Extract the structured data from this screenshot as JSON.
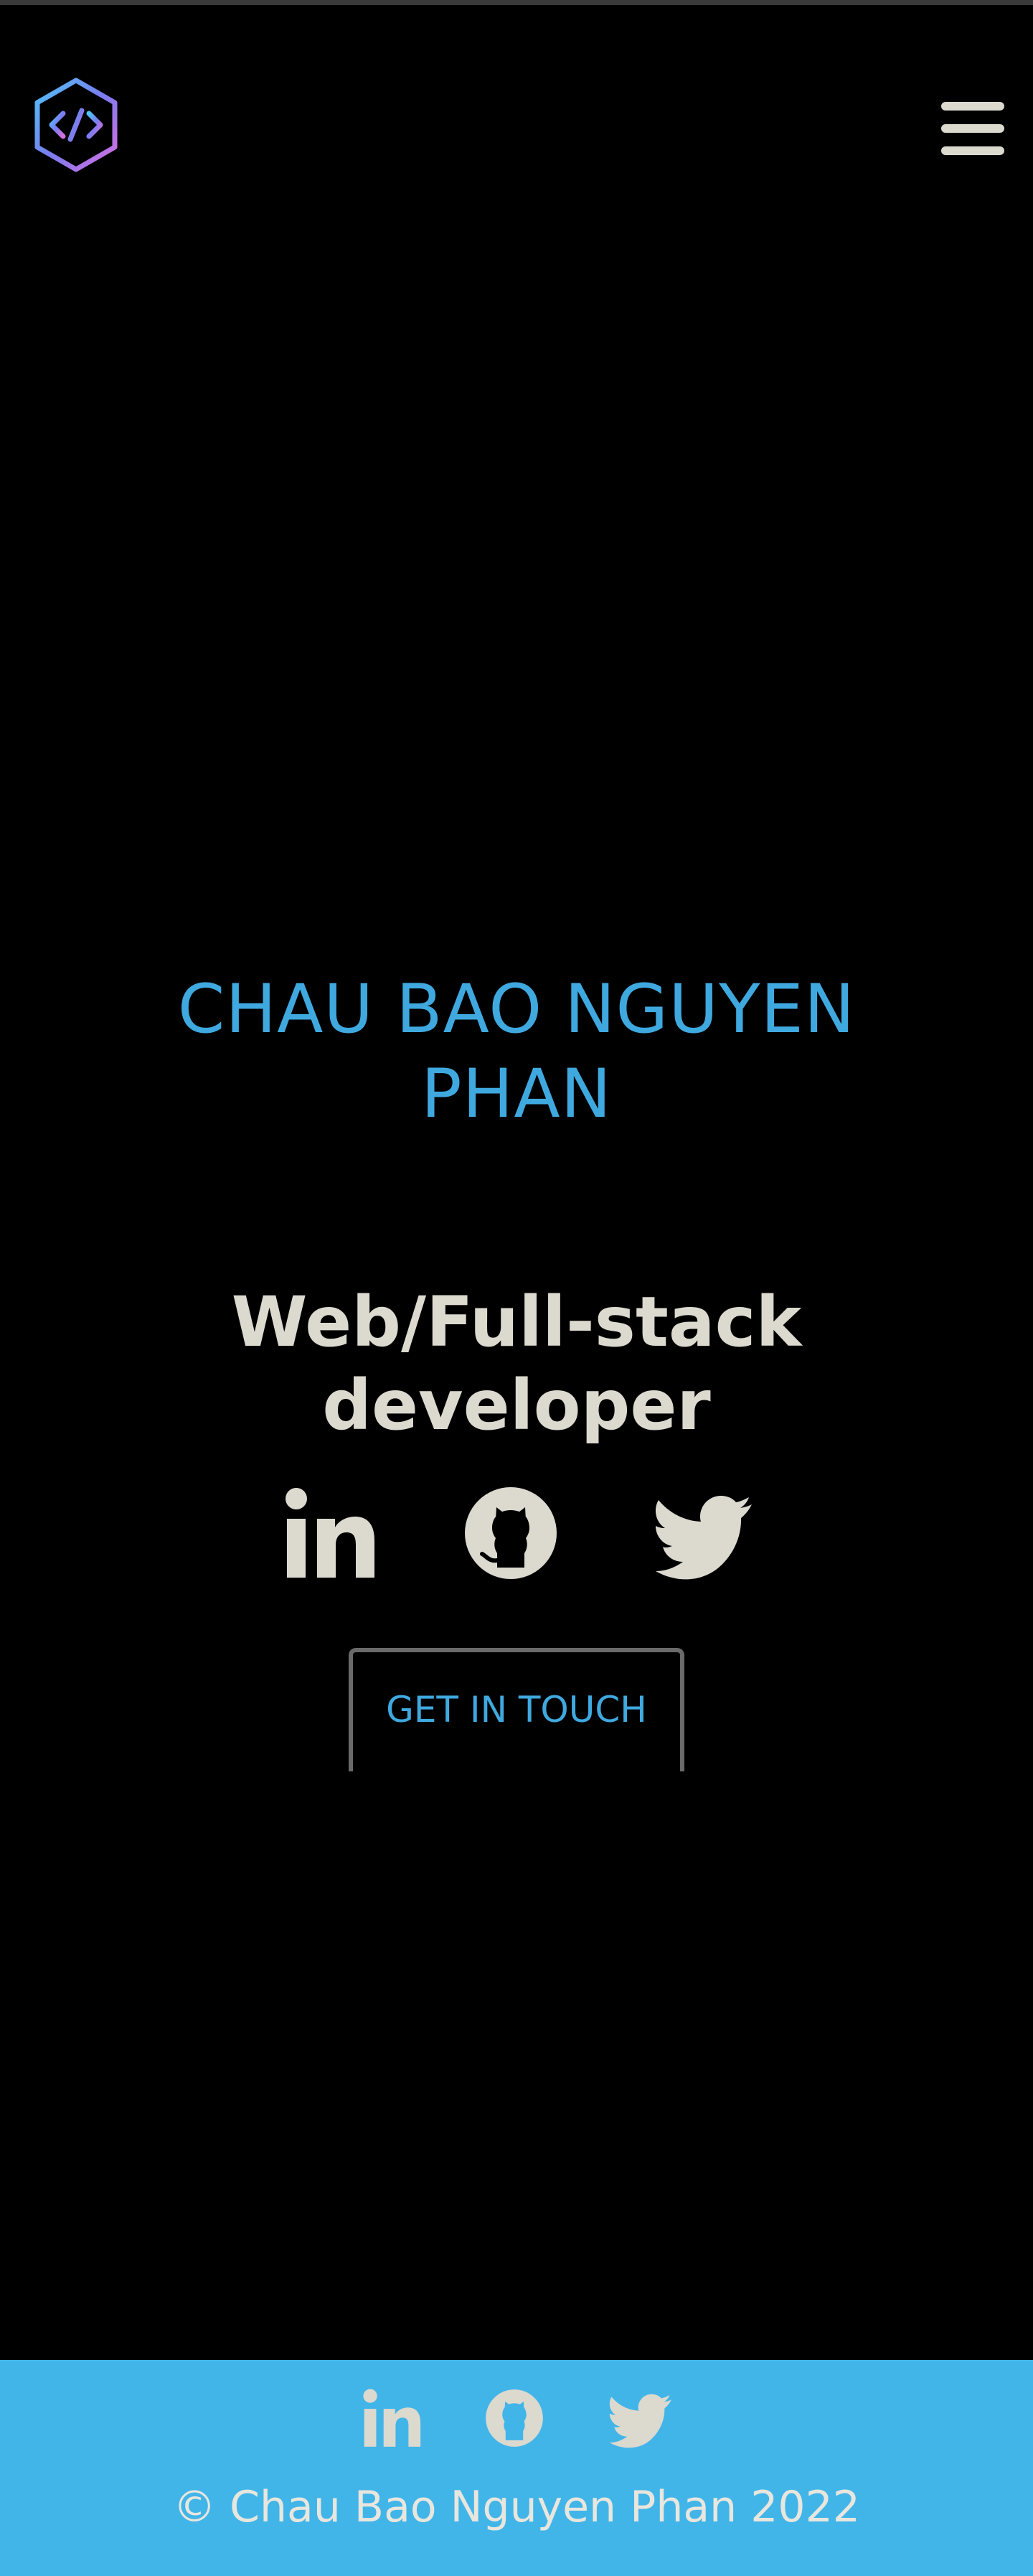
{
  "header": {
    "logo_icon": "code-hexagon-icon",
    "menu_icon": "hamburger-menu-icon"
  },
  "hero": {
    "name_line1": "CHAU BAO NGUYEN",
    "name_line2": "PHAN",
    "role_line1": "Web/Full-stack",
    "role_line2": "developer",
    "cta_label": "GET IN TOUCH"
  },
  "social": [
    {
      "name": "LinkedIn",
      "icon": "linkedin-icon"
    },
    {
      "name": "GitHub",
      "icon": "github-icon"
    },
    {
      "name": "Twitter",
      "icon": "twitter-icon"
    }
  ],
  "footer": {
    "copyright": "© Chau Bao Nguyen Phan 2022"
  },
  "colors": {
    "background": "#000000",
    "accent": "#3fa9df",
    "text_light": "#dcd9cf",
    "footer_bg": "#41b5e8"
  }
}
